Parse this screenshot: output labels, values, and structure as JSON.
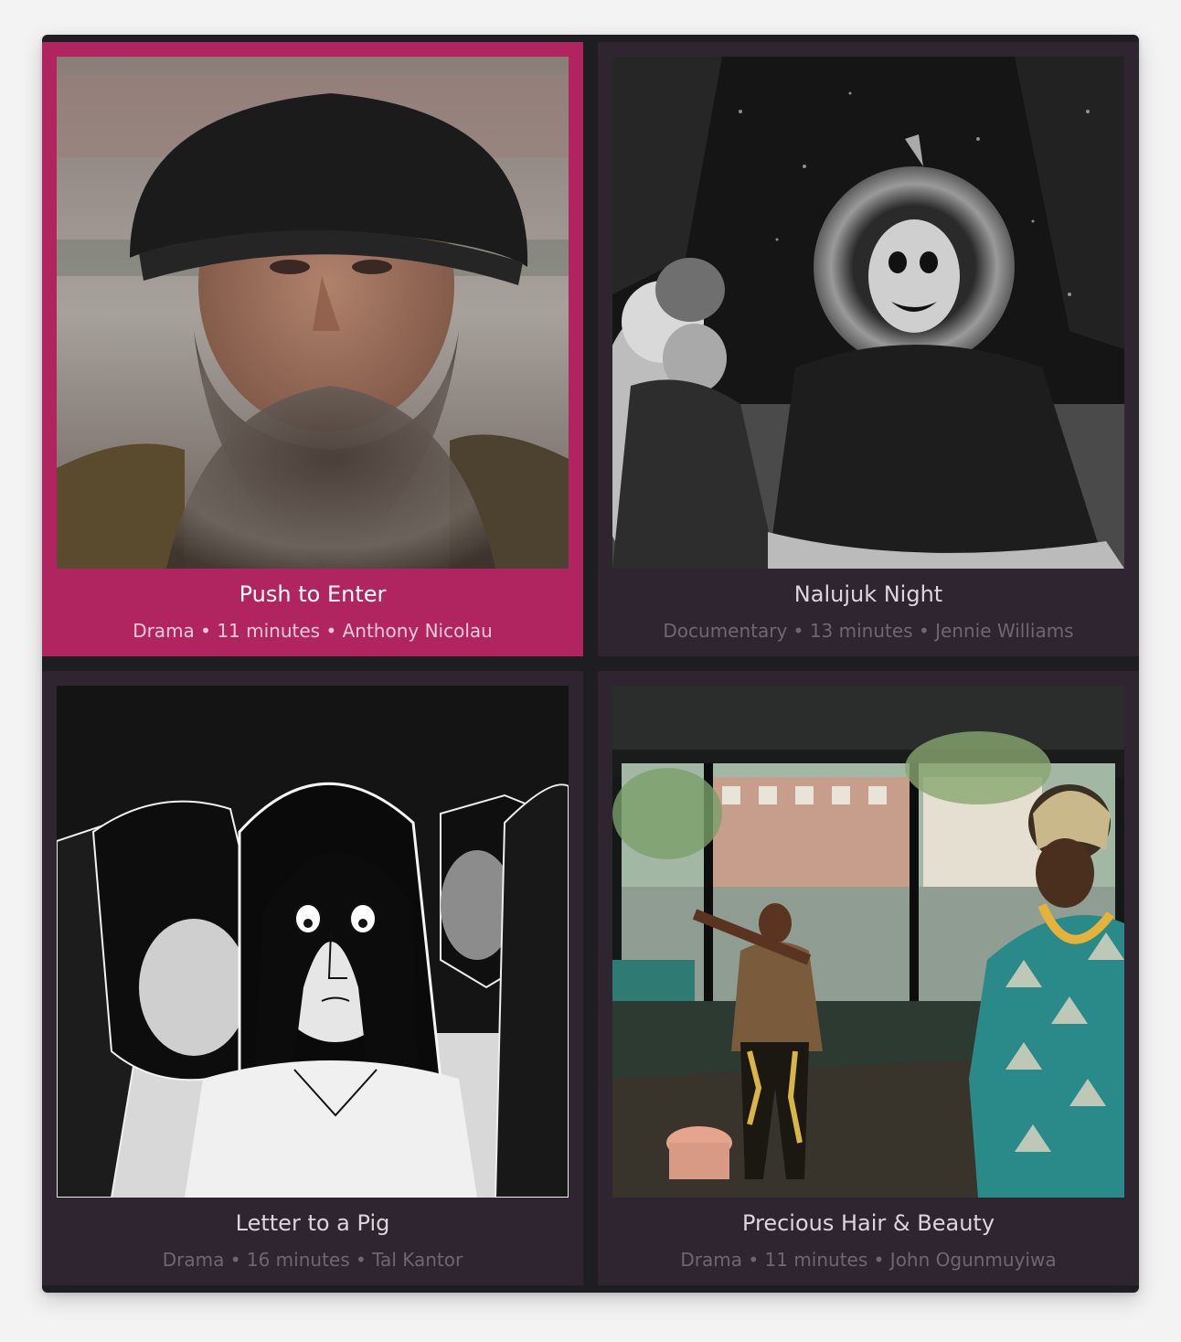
{
  "films": [
    {
      "title": "Push to Enter",
      "meta": "Drama • 11 minutes • Anthony Nicolau",
      "selected": true,
      "thumbnail": "bearded-man-portrait"
    },
    {
      "title": "Nalujuk Night",
      "meta": "Documentary • 13 minutes • Jennie Williams",
      "selected": false,
      "thumbnail": "masked-figure-snow"
    },
    {
      "title": "Letter to a Pig",
      "meta": "Drama • 16 minutes • Tal Kantor",
      "selected": false,
      "thumbnail": "illustrated-children"
    },
    {
      "title": "Precious Hair & Beauty",
      "meta": "Drama • 11 minutes • John Ogunmuyiwa",
      "selected": false,
      "thumbnail": "salon-dancers"
    }
  ],
  "colors": {
    "selected_card": "#b02560",
    "card": "#2f2530",
    "window": "#1e1d21"
  }
}
